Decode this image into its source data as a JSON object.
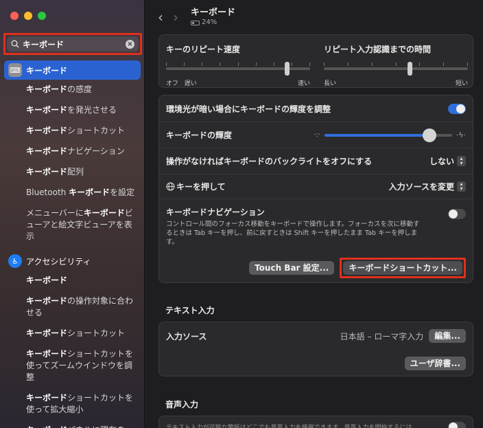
{
  "sidebar": {
    "search": {
      "value": "キーボード",
      "placeholder": "検索"
    },
    "items": [
      {
        "pre": "",
        "bold": "キーボード",
        "post": "",
        "head": true,
        "selected": true,
        "icon": "keyboard-icon"
      },
      {
        "pre": "",
        "bold": "キーボード",
        "post": "の感度"
      },
      {
        "pre": "",
        "bold": "キーボード",
        "post": "を発光させる"
      },
      {
        "pre": "",
        "bold": "キーボード",
        "post": "ショートカット"
      },
      {
        "pre": "",
        "bold": "キーボード",
        "post": "ナビゲーション"
      },
      {
        "pre": "",
        "bold": "キーボード",
        "post": "配列"
      },
      {
        "pre": "Bluetooth ",
        "bold": "キーボード",
        "post": "を設定"
      },
      {
        "pre": "メニューバーに",
        "bold": "キーボード",
        "post": "ビューアと絵文字ビューアを表示"
      },
      {
        "pre": "アクセシビリティ",
        "bold": "",
        "post": "",
        "head": true,
        "selected": false,
        "icon": "accessibility-icon"
      },
      {
        "pre": "",
        "bold": "キーボード",
        "post": ""
      },
      {
        "pre": "",
        "bold": "キーボード",
        "post": "の操作対象に合わせる"
      },
      {
        "pre": "",
        "bold": "キーボード",
        "post": "ショートカット"
      },
      {
        "pre": "",
        "bold": "キーボード",
        "post": "ショートカットを使ってズームウインドウを調整"
      },
      {
        "pre": "",
        "bold": "キーボード",
        "post": "ショートカットを使って拡大縮小"
      },
      {
        "pre": "",
        "bold": "キーボード",
        "post": "パネルに現在の"
      }
    ]
  },
  "header": {
    "title": "キーボード",
    "battery": "24%"
  },
  "repeat": {
    "speed_label": "キーのリピート速度",
    "speed_left": "オフ",
    "speed_left2": "遅い",
    "speed_right": "速い",
    "speed_level": 0.85,
    "delay_label": "リピート入力認識までの時間",
    "delay_left": "長い",
    "delay_right": "短い",
    "delay_level": 0.6
  },
  "settings": {
    "ambient_label": "環境光が暗い場合にキーボードの輝度を調整",
    "brightness_label": "キーボードの輝度",
    "brightness_level": 0.82,
    "backlight_label": "操作がなければキーボードのバックライトをオフにする",
    "backlight_value": "しない",
    "globe_label": "キーを押して",
    "globe_value": "入力ソースを変更",
    "nav_label": "キーボードナビゲーション",
    "nav_desc": "コントロール間のフォーカス移動をキーボードで操作します。フォーカスを次に移動するときは Tab キーを押し、前に戻すときは Shift キーを押したまま Tab キーを押します。",
    "touchbar_button": "Touch Bar 設定...",
    "shortcuts_button": "キーボードショートカット..."
  },
  "text_input": {
    "section": "テキスト入力",
    "source_label": "入力ソース",
    "source_value": "日本語 – ローマ字入力",
    "edit_button": "編集...",
    "dict_button": "ユーザ辞書..."
  },
  "voice": {
    "section": "音声入力",
    "desc": "テキスト入力が可能な箇所はどこでも音声入力を使用できます。音声入力を開始するには"
  },
  "colors": {
    "accent": "#2a63d1",
    "highlight": "#e0301e"
  }
}
